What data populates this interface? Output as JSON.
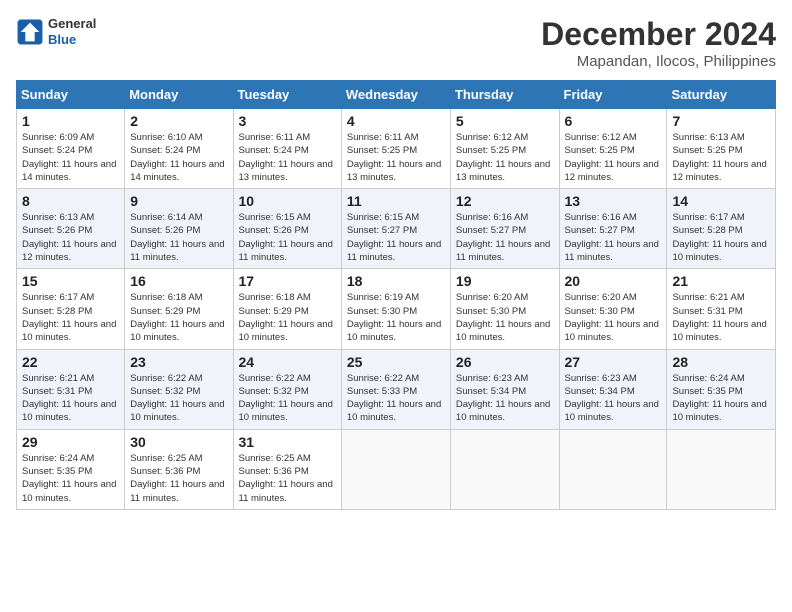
{
  "header": {
    "logo_line1": "General",
    "logo_line2": "Blue",
    "month_year": "December 2024",
    "location": "Mapandan, Ilocos, Philippines"
  },
  "weekdays": [
    "Sunday",
    "Monday",
    "Tuesday",
    "Wednesday",
    "Thursday",
    "Friday",
    "Saturday"
  ],
  "weeks": [
    [
      {
        "day": "1",
        "info": "Sunrise: 6:09 AM\nSunset: 5:24 PM\nDaylight: 11 hours and 14 minutes."
      },
      {
        "day": "2",
        "info": "Sunrise: 6:10 AM\nSunset: 5:24 PM\nDaylight: 11 hours and 14 minutes."
      },
      {
        "day": "3",
        "info": "Sunrise: 6:11 AM\nSunset: 5:24 PM\nDaylight: 11 hours and 13 minutes."
      },
      {
        "day": "4",
        "info": "Sunrise: 6:11 AM\nSunset: 5:25 PM\nDaylight: 11 hours and 13 minutes."
      },
      {
        "day": "5",
        "info": "Sunrise: 6:12 AM\nSunset: 5:25 PM\nDaylight: 11 hours and 13 minutes."
      },
      {
        "day": "6",
        "info": "Sunrise: 6:12 AM\nSunset: 5:25 PM\nDaylight: 11 hours and 12 minutes."
      },
      {
        "day": "7",
        "info": "Sunrise: 6:13 AM\nSunset: 5:25 PM\nDaylight: 11 hours and 12 minutes."
      }
    ],
    [
      {
        "day": "8",
        "info": "Sunrise: 6:13 AM\nSunset: 5:26 PM\nDaylight: 11 hours and 12 minutes."
      },
      {
        "day": "9",
        "info": "Sunrise: 6:14 AM\nSunset: 5:26 PM\nDaylight: 11 hours and 11 minutes."
      },
      {
        "day": "10",
        "info": "Sunrise: 6:15 AM\nSunset: 5:26 PM\nDaylight: 11 hours and 11 minutes."
      },
      {
        "day": "11",
        "info": "Sunrise: 6:15 AM\nSunset: 5:27 PM\nDaylight: 11 hours and 11 minutes."
      },
      {
        "day": "12",
        "info": "Sunrise: 6:16 AM\nSunset: 5:27 PM\nDaylight: 11 hours and 11 minutes."
      },
      {
        "day": "13",
        "info": "Sunrise: 6:16 AM\nSunset: 5:27 PM\nDaylight: 11 hours and 11 minutes."
      },
      {
        "day": "14",
        "info": "Sunrise: 6:17 AM\nSunset: 5:28 PM\nDaylight: 11 hours and 10 minutes."
      }
    ],
    [
      {
        "day": "15",
        "info": "Sunrise: 6:17 AM\nSunset: 5:28 PM\nDaylight: 11 hours and 10 minutes."
      },
      {
        "day": "16",
        "info": "Sunrise: 6:18 AM\nSunset: 5:29 PM\nDaylight: 11 hours and 10 minutes."
      },
      {
        "day": "17",
        "info": "Sunrise: 6:18 AM\nSunset: 5:29 PM\nDaylight: 11 hours and 10 minutes."
      },
      {
        "day": "18",
        "info": "Sunrise: 6:19 AM\nSunset: 5:30 PM\nDaylight: 11 hours and 10 minutes."
      },
      {
        "day": "19",
        "info": "Sunrise: 6:20 AM\nSunset: 5:30 PM\nDaylight: 11 hours and 10 minutes."
      },
      {
        "day": "20",
        "info": "Sunrise: 6:20 AM\nSunset: 5:30 PM\nDaylight: 11 hours and 10 minutes."
      },
      {
        "day": "21",
        "info": "Sunrise: 6:21 AM\nSunset: 5:31 PM\nDaylight: 11 hours and 10 minutes."
      }
    ],
    [
      {
        "day": "22",
        "info": "Sunrise: 6:21 AM\nSunset: 5:31 PM\nDaylight: 11 hours and 10 minutes."
      },
      {
        "day": "23",
        "info": "Sunrise: 6:22 AM\nSunset: 5:32 PM\nDaylight: 11 hours and 10 minutes."
      },
      {
        "day": "24",
        "info": "Sunrise: 6:22 AM\nSunset: 5:32 PM\nDaylight: 11 hours and 10 minutes."
      },
      {
        "day": "25",
        "info": "Sunrise: 6:22 AM\nSunset: 5:33 PM\nDaylight: 11 hours and 10 minutes."
      },
      {
        "day": "26",
        "info": "Sunrise: 6:23 AM\nSunset: 5:34 PM\nDaylight: 11 hours and 10 minutes."
      },
      {
        "day": "27",
        "info": "Sunrise: 6:23 AM\nSunset: 5:34 PM\nDaylight: 11 hours and 10 minutes."
      },
      {
        "day": "28",
        "info": "Sunrise: 6:24 AM\nSunset: 5:35 PM\nDaylight: 11 hours and 10 minutes."
      }
    ],
    [
      {
        "day": "29",
        "info": "Sunrise: 6:24 AM\nSunset: 5:35 PM\nDaylight: 11 hours and 10 minutes."
      },
      {
        "day": "30",
        "info": "Sunrise: 6:25 AM\nSunset: 5:36 PM\nDaylight: 11 hours and 11 minutes."
      },
      {
        "day": "31",
        "info": "Sunrise: 6:25 AM\nSunset: 5:36 PM\nDaylight: 11 hours and 11 minutes."
      },
      null,
      null,
      null,
      null
    ]
  ]
}
